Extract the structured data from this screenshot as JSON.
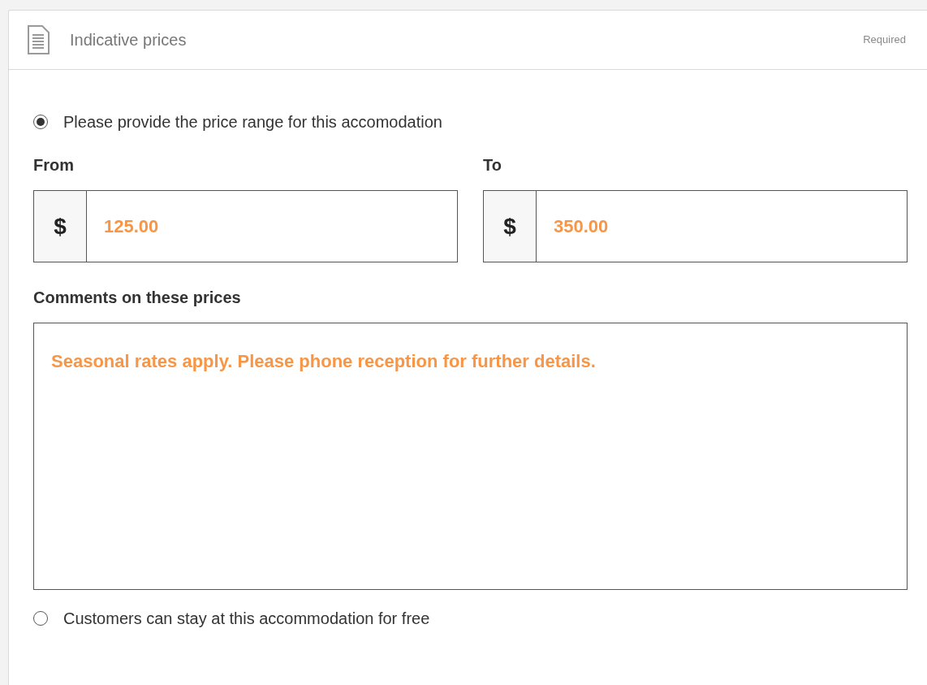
{
  "header": {
    "title": "Indicative prices",
    "badge": "Required"
  },
  "options": [
    {
      "label": "Please provide the price range for this accomodation",
      "selected": true
    },
    {
      "label": "Customers can stay at this accommodation for free",
      "selected": false
    }
  ],
  "price_fields": [
    {
      "label": "From",
      "currency": "$",
      "value": "125.00"
    },
    {
      "label": "To",
      "currency": "$",
      "value": "350.00"
    }
  ],
  "comments": {
    "label": "Comments on these prices",
    "value": "Seasonal rates apply. Please phone reception for further details."
  }
}
